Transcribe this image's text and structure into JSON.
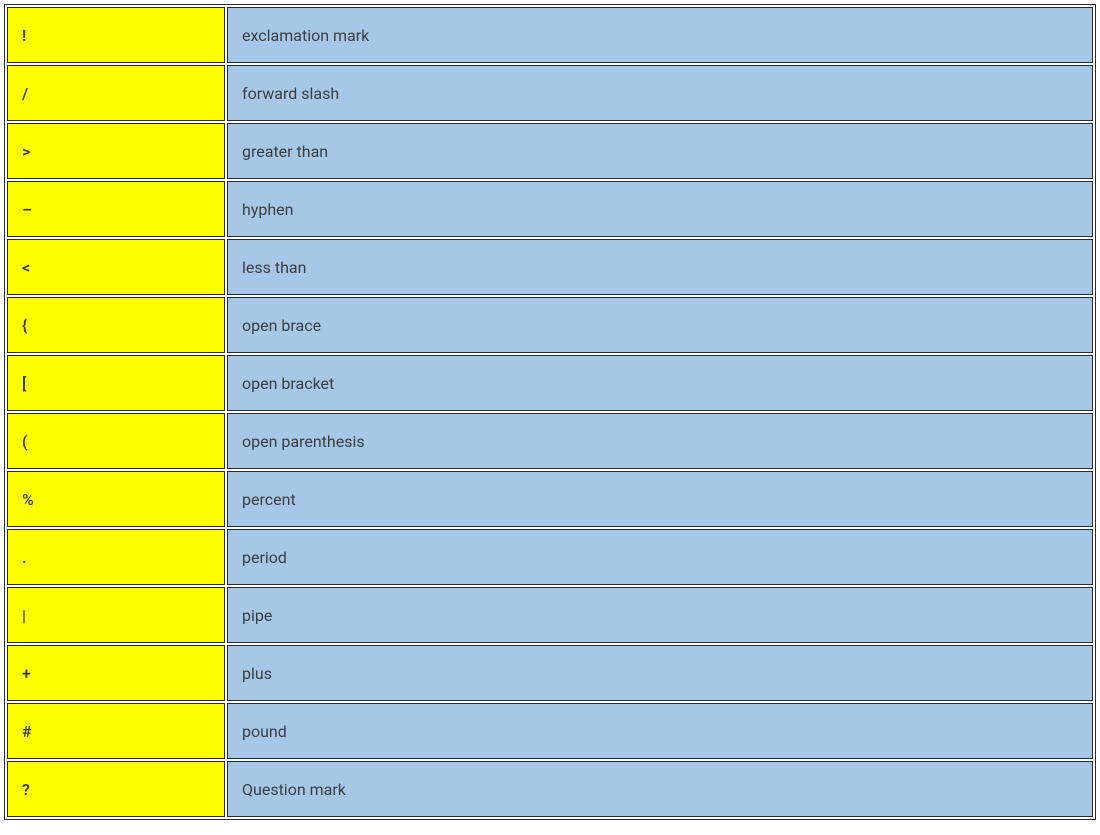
{
  "rows": [
    {
      "symbol": "!",
      "name": "exclamation mark"
    },
    {
      "symbol": "/",
      "name": "forward slash"
    },
    {
      "symbol": ">",
      "name": "greater than"
    },
    {
      "symbol": "–",
      "name": "hyphen"
    },
    {
      "symbol": "<",
      "name": "less than"
    },
    {
      "symbol": "{",
      "name": "open brace"
    },
    {
      "symbol": "[",
      "name": "open bracket"
    },
    {
      "symbol": "(",
      "name": "open parenthesis"
    },
    {
      "symbol": "%",
      "name": "percent"
    },
    {
      "symbol": ".",
      "name": "period"
    },
    {
      "symbol": "|",
      "name": "pipe"
    },
    {
      "symbol": "+",
      "name": "plus"
    },
    {
      "symbol": "#",
      "name": "pound"
    },
    {
      "symbol": "?",
      "name": "Question mark"
    }
  ]
}
